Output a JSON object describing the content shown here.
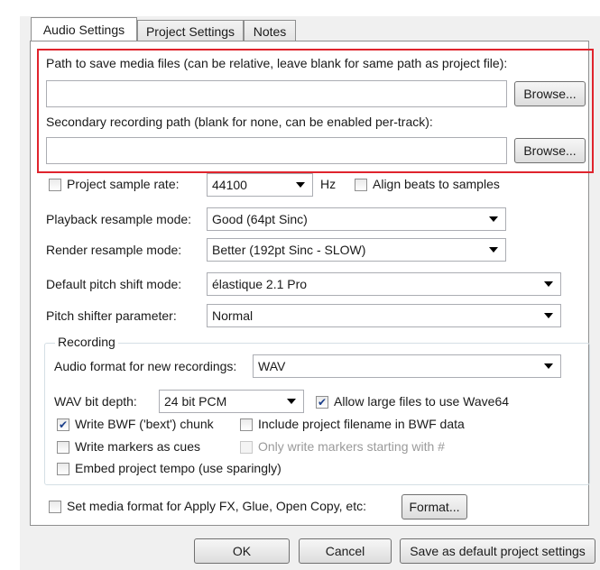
{
  "tabs": [
    {
      "label": "Audio Settings",
      "active": true
    },
    {
      "label": "Project Settings",
      "active": false
    },
    {
      "label": "Notes",
      "active": false
    }
  ],
  "media_path": {
    "label": "Path to save media files (can be relative, leave blank for same path as project file):",
    "value": "",
    "browse_label": "Browse..."
  },
  "secondary_path": {
    "label": "Secondary recording path (blank for none, can be enabled per-track):",
    "value": "",
    "browse_label": "Browse..."
  },
  "sample_rate": {
    "label": "Project sample rate:",
    "checked": false,
    "value": "44100",
    "unit": "Hz",
    "align_beats_label": "Align beats to samples",
    "align_beats_checked": false
  },
  "playback_resample": {
    "label": "Playback resample mode:",
    "value": "Good (64pt Sinc)"
  },
  "render_resample": {
    "label": "Render resample mode:",
    "value": "Better (192pt Sinc - SLOW)"
  },
  "pitch_shift": {
    "label": "Default pitch shift mode:",
    "value": "élastique 2.1 Pro"
  },
  "pitch_param": {
    "label": "Pitch shifter parameter:",
    "value": "Normal"
  },
  "recording": {
    "group_title": "Recording",
    "format_label": "Audio format for new recordings:",
    "format_value": "WAV",
    "bit_depth_label": "WAV bit depth:",
    "bit_depth_value": "24 bit PCM",
    "wave64_label": "Allow large files to use Wave64",
    "wave64_checked": true,
    "bwf_label": "Write BWF ('bext') chunk",
    "bwf_checked": true,
    "include_filename_label": "Include project filename in BWF data",
    "include_filename_checked": false,
    "markers_cues_label": "Write markers as cues",
    "markers_cues_checked": false,
    "only_markers_label": "Only write markers starting with #",
    "only_markers_checked": false,
    "embed_tempo_label": "Embed project tempo (use sparingly)",
    "embed_tempo_checked": false
  },
  "media_format": {
    "label": "Set media format for Apply FX, Glue, Open Copy, etc:",
    "checked": false,
    "button_label": "Format..."
  },
  "footer": {
    "ok_label": "OK",
    "cancel_label": "Cancel",
    "save_default_label": "Save as default project settings"
  },
  "colors": {
    "highlight_border": "#e0242d",
    "check_mark": "#1b3f8b"
  }
}
